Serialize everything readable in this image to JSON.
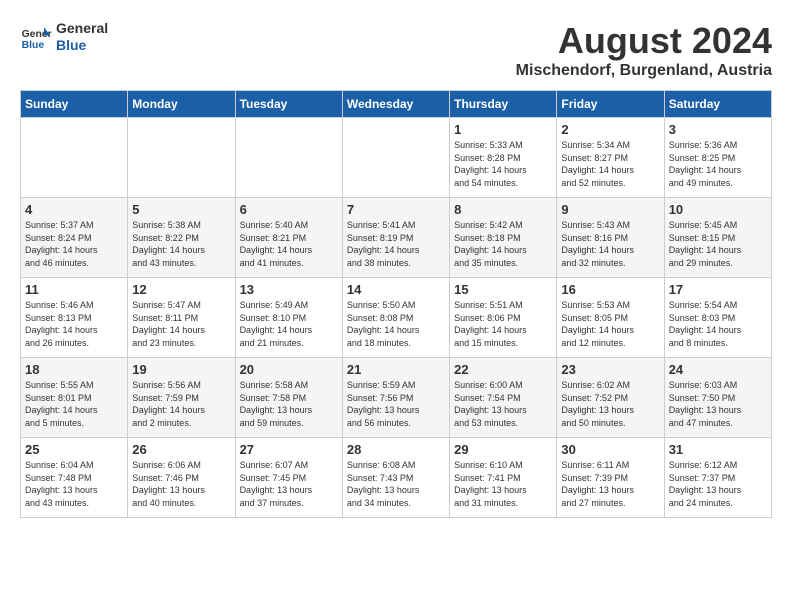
{
  "header": {
    "logo_line1": "General",
    "logo_line2": "Blue",
    "month_year": "August 2024",
    "location": "Mischendorf, Burgenland, Austria"
  },
  "weekdays": [
    "Sunday",
    "Monday",
    "Tuesday",
    "Wednesday",
    "Thursday",
    "Friday",
    "Saturday"
  ],
  "weeks": [
    [
      {
        "day": "",
        "content": ""
      },
      {
        "day": "",
        "content": ""
      },
      {
        "day": "",
        "content": ""
      },
      {
        "day": "",
        "content": ""
      },
      {
        "day": "1",
        "content": "Sunrise: 5:33 AM\nSunset: 8:28 PM\nDaylight: 14 hours\nand 54 minutes."
      },
      {
        "day": "2",
        "content": "Sunrise: 5:34 AM\nSunset: 8:27 PM\nDaylight: 14 hours\nand 52 minutes."
      },
      {
        "day": "3",
        "content": "Sunrise: 5:36 AM\nSunset: 8:25 PM\nDaylight: 14 hours\nand 49 minutes."
      }
    ],
    [
      {
        "day": "4",
        "content": "Sunrise: 5:37 AM\nSunset: 8:24 PM\nDaylight: 14 hours\nand 46 minutes."
      },
      {
        "day": "5",
        "content": "Sunrise: 5:38 AM\nSunset: 8:22 PM\nDaylight: 14 hours\nand 43 minutes."
      },
      {
        "day": "6",
        "content": "Sunrise: 5:40 AM\nSunset: 8:21 PM\nDaylight: 14 hours\nand 41 minutes."
      },
      {
        "day": "7",
        "content": "Sunrise: 5:41 AM\nSunset: 8:19 PM\nDaylight: 14 hours\nand 38 minutes."
      },
      {
        "day": "8",
        "content": "Sunrise: 5:42 AM\nSunset: 8:18 PM\nDaylight: 14 hours\nand 35 minutes."
      },
      {
        "day": "9",
        "content": "Sunrise: 5:43 AM\nSunset: 8:16 PM\nDaylight: 14 hours\nand 32 minutes."
      },
      {
        "day": "10",
        "content": "Sunrise: 5:45 AM\nSunset: 8:15 PM\nDaylight: 14 hours\nand 29 minutes."
      }
    ],
    [
      {
        "day": "11",
        "content": "Sunrise: 5:46 AM\nSunset: 8:13 PM\nDaylight: 14 hours\nand 26 minutes."
      },
      {
        "day": "12",
        "content": "Sunrise: 5:47 AM\nSunset: 8:11 PM\nDaylight: 14 hours\nand 23 minutes."
      },
      {
        "day": "13",
        "content": "Sunrise: 5:49 AM\nSunset: 8:10 PM\nDaylight: 14 hours\nand 21 minutes."
      },
      {
        "day": "14",
        "content": "Sunrise: 5:50 AM\nSunset: 8:08 PM\nDaylight: 14 hours\nand 18 minutes."
      },
      {
        "day": "15",
        "content": "Sunrise: 5:51 AM\nSunset: 8:06 PM\nDaylight: 14 hours\nand 15 minutes."
      },
      {
        "day": "16",
        "content": "Sunrise: 5:53 AM\nSunset: 8:05 PM\nDaylight: 14 hours\nand 12 minutes."
      },
      {
        "day": "17",
        "content": "Sunrise: 5:54 AM\nSunset: 8:03 PM\nDaylight: 14 hours\nand 8 minutes."
      }
    ],
    [
      {
        "day": "18",
        "content": "Sunrise: 5:55 AM\nSunset: 8:01 PM\nDaylight: 14 hours\nand 5 minutes."
      },
      {
        "day": "19",
        "content": "Sunrise: 5:56 AM\nSunset: 7:59 PM\nDaylight: 14 hours\nand 2 minutes."
      },
      {
        "day": "20",
        "content": "Sunrise: 5:58 AM\nSunset: 7:58 PM\nDaylight: 13 hours\nand 59 minutes."
      },
      {
        "day": "21",
        "content": "Sunrise: 5:59 AM\nSunset: 7:56 PM\nDaylight: 13 hours\nand 56 minutes."
      },
      {
        "day": "22",
        "content": "Sunrise: 6:00 AM\nSunset: 7:54 PM\nDaylight: 13 hours\nand 53 minutes."
      },
      {
        "day": "23",
        "content": "Sunrise: 6:02 AM\nSunset: 7:52 PM\nDaylight: 13 hours\nand 50 minutes."
      },
      {
        "day": "24",
        "content": "Sunrise: 6:03 AM\nSunset: 7:50 PM\nDaylight: 13 hours\nand 47 minutes."
      }
    ],
    [
      {
        "day": "25",
        "content": "Sunrise: 6:04 AM\nSunset: 7:48 PM\nDaylight: 13 hours\nand 43 minutes."
      },
      {
        "day": "26",
        "content": "Sunrise: 6:06 AM\nSunset: 7:46 PM\nDaylight: 13 hours\nand 40 minutes."
      },
      {
        "day": "27",
        "content": "Sunrise: 6:07 AM\nSunset: 7:45 PM\nDaylight: 13 hours\nand 37 minutes."
      },
      {
        "day": "28",
        "content": "Sunrise: 6:08 AM\nSunset: 7:43 PM\nDaylight: 13 hours\nand 34 minutes."
      },
      {
        "day": "29",
        "content": "Sunrise: 6:10 AM\nSunset: 7:41 PM\nDaylight: 13 hours\nand 31 minutes."
      },
      {
        "day": "30",
        "content": "Sunrise: 6:11 AM\nSunset: 7:39 PM\nDaylight: 13 hours\nand 27 minutes."
      },
      {
        "day": "31",
        "content": "Sunrise: 6:12 AM\nSunset: 7:37 PM\nDaylight: 13 hours\nand 24 minutes."
      }
    ]
  ]
}
